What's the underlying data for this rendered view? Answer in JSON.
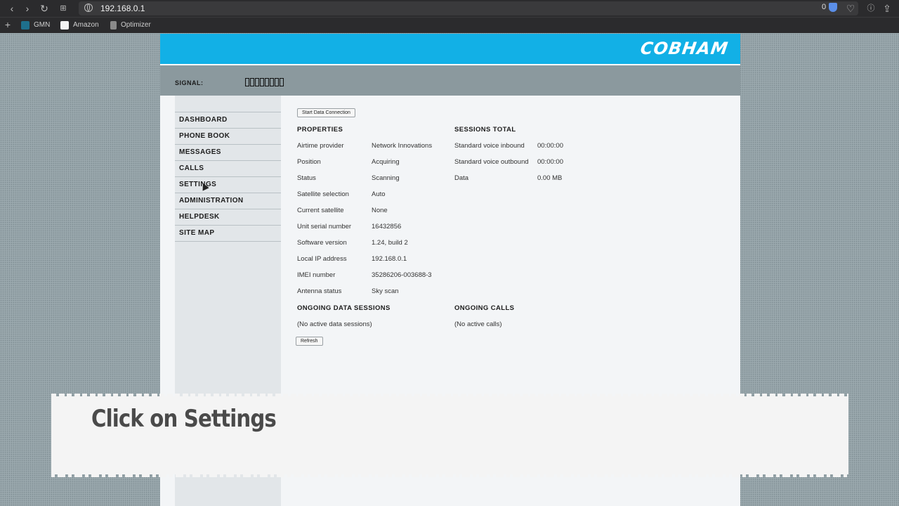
{
  "browser": {
    "url": "192.168.0.1",
    "extension_count": "0",
    "bookmarks": [
      {
        "label": "GMN",
        "color": "#1e6f8c"
      },
      {
        "label": "Amazon",
        "color": "#f3f3f3"
      },
      {
        "label": "Optimizer",
        "color": "#8a8a8a"
      }
    ]
  },
  "header": {
    "logo": "COBHAM",
    "brand_color": "#12b0e6",
    "signal_label": "SIGNAL:",
    "signal_level": 0
  },
  "sidebar": {
    "items": [
      {
        "label": "DASHBOARD"
      },
      {
        "label": "PHONE BOOK"
      },
      {
        "label": "MESSAGES"
      },
      {
        "label": "CALLS"
      },
      {
        "label": "SETTINGS"
      },
      {
        "label": "ADMINISTRATION"
      },
      {
        "label": "HELPDESK"
      },
      {
        "label": "SITE MAP"
      }
    ]
  },
  "main": {
    "start_button": "Start Data Connection",
    "properties_heading": "PROPERTIES",
    "properties": [
      {
        "label": "Airtime provider",
        "value": "Network Innovations"
      },
      {
        "label": "Position",
        "value": "Acquiring"
      },
      {
        "label": "Status",
        "value": "Scanning"
      },
      {
        "label": "Satellite selection",
        "value": "Auto"
      },
      {
        "label": "Current satellite",
        "value": "None"
      },
      {
        "label": "Unit serial number",
        "value": "16432856"
      },
      {
        "label": "Software version",
        "value": "1.24, build 2"
      },
      {
        "label": "Local IP address",
        "value": "192.168.0.1"
      },
      {
        "label": "IMEI number",
        "value": "35286206-003688-3"
      },
      {
        "label": "Antenna status",
        "value": "Sky scan"
      }
    ],
    "sessions_heading": "SESSIONS TOTAL",
    "sessions": [
      {
        "label": "Standard voice inbound",
        "value": "00:00:00"
      },
      {
        "label": "Standard voice outbound",
        "value": "00:00:00"
      },
      {
        "label": "Data",
        "value": "0.00 MB"
      }
    ],
    "ongoing_data_heading": "ONGOING DATA SESSIONS",
    "ongoing_data_text": "(No active data sessions)",
    "ongoing_calls_heading": "ONGOING CALLS",
    "ongoing_calls_text": "(No active calls)",
    "refresh_button": "Refresh"
  },
  "caption": "Click on Settings"
}
